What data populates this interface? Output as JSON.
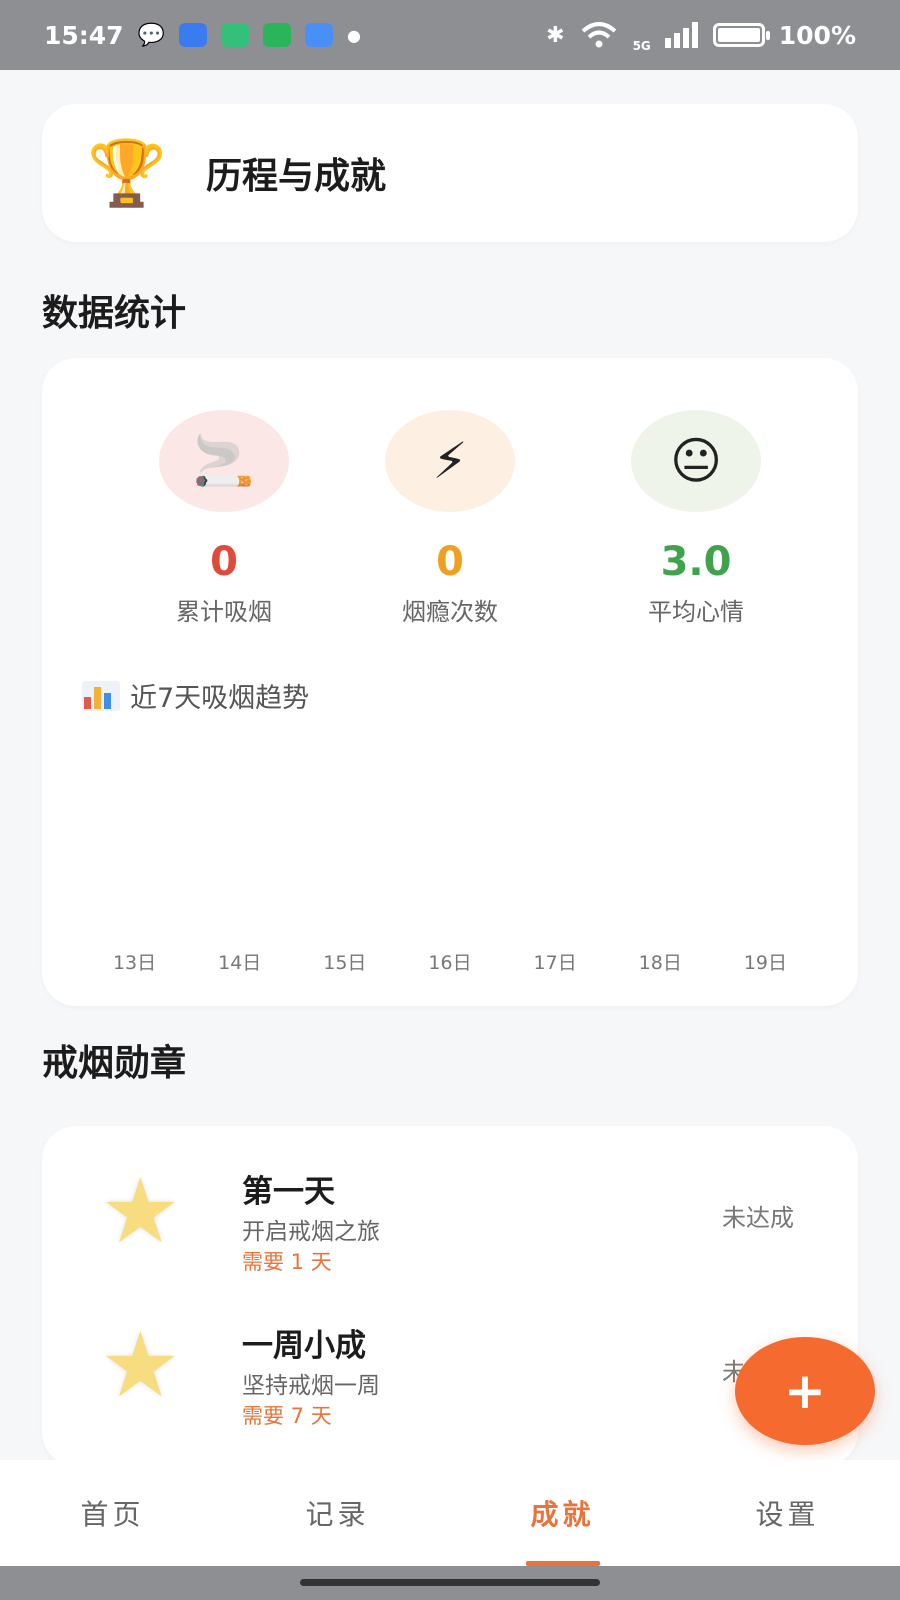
{
  "status_bar": {
    "time": "15:47",
    "network": "5G",
    "battery": "100%",
    "battery_level": 1.0,
    "icons": [
      "wechat-icon",
      "app-icon-blue",
      "app-icon-green",
      "shield-app-icon",
      "browser-app-icon",
      "dot-icon",
      "bluetooth-icon",
      "wifi-icon",
      "signal-icon",
      "battery-icon"
    ]
  },
  "header": {
    "icon": "🏆",
    "title": "历程与成就"
  },
  "stats_section": {
    "title": "数据统计",
    "stats": [
      {
        "icon": "🚬",
        "value": "0",
        "label": "累计吸烟",
        "color": "#e04a3a",
        "bg": "#fbe8e6"
      },
      {
        "icon": "⚡",
        "value": "0",
        "label": "烟瘾次数",
        "color": "#f0a020",
        "bg": "#fdf0e3"
      },
      {
        "icon": "😐",
        "value": "3.0",
        "label": "平均心情",
        "color": "#3fa34d",
        "bg": "#eef4ea"
      }
    ],
    "trend": {
      "title": "近7天吸烟趋势",
      "days": [
        "13日",
        "14日",
        "15日",
        "16日",
        "17日",
        "18日",
        "19日"
      ]
    }
  },
  "badges_section": {
    "title": "戒烟勋章",
    "badges": [
      {
        "name": "第一天",
        "desc": "开启戒烟之旅",
        "need": "需要 1 天",
        "status": "未达成"
      },
      {
        "name": "一周小成",
        "desc": "坚持戒烟一周",
        "need": "需要 7 天",
        "status": "未达成"
      }
    ]
  },
  "fab": {
    "label": "+"
  },
  "tabs": [
    {
      "label": "首页"
    },
    {
      "label": "记录"
    },
    {
      "label": "成就"
    },
    {
      "label": "设置"
    }
  ],
  "colors": {
    "accent": "#e8743b",
    "fab": "#f46a2f"
  }
}
